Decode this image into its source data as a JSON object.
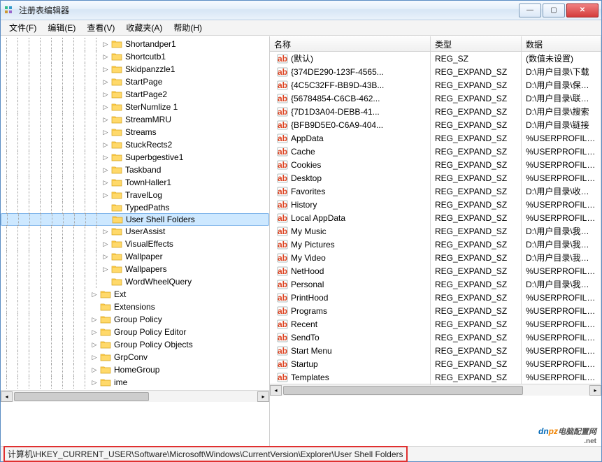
{
  "window": {
    "title": "注册表编辑器"
  },
  "menu": {
    "file": "文件(F)",
    "edit": "编辑(E)",
    "view": "查看(V)",
    "favorites": "收藏夹(A)",
    "help": "帮助(H)"
  },
  "tree": {
    "items": [
      {
        "depth": 9,
        "toggle": "▷",
        "label": "Shortandper1"
      },
      {
        "depth": 9,
        "toggle": "▷",
        "label": "Shortcutb1"
      },
      {
        "depth": 9,
        "toggle": "▷",
        "label": "Skidpanzzle1"
      },
      {
        "depth": 9,
        "toggle": "▷",
        "label": "StartPage"
      },
      {
        "depth": 9,
        "toggle": "▷",
        "label": "StartPage2"
      },
      {
        "depth": 9,
        "toggle": "▷",
        "label": "SterNumlize 1"
      },
      {
        "depth": 9,
        "toggle": "▷",
        "label": "StreamMRU"
      },
      {
        "depth": 9,
        "toggle": "▷",
        "label": "Streams"
      },
      {
        "depth": 9,
        "toggle": "▷",
        "label": "StuckRects2"
      },
      {
        "depth": 9,
        "toggle": "▷",
        "label": "Superbgestive1"
      },
      {
        "depth": 9,
        "toggle": "▷",
        "label": "Taskband"
      },
      {
        "depth": 9,
        "toggle": "▷",
        "label": "TownHaller1"
      },
      {
        "depth": 9,
        "toggle": "▷",
        "label": "TravelLog"
      },
      {
        "depth": 9,
        "toggle": "",
        "label": "TypedPaths"
      },
      {
        "depth": 9,
        "toggle": "",
        "label": "User Shell Folders",
        "selected": true
      },
      {
        "depth": 9,
        "toggle": "▷",
        "label": "UserAssist"
      },
      {
        "depth": 9,
        "toggle": "▷",
        "label": "VisualEffects"
      },
      {
        "depth": 9,
        "toggle": "▷",
        "label": "Wallpaper"
      },
      {
        "depth": 9,
        "toggle": "▷",
        "label": "Wallpapers"
      },
      {
        "depth": 9,
        "toggle": "",
        "label": "WordWheelQuery"
      },
      {
        "depth": 8,
        "toggle": "▷",
        "label": "Ext"
      },
      {
        "depth": 8,
        "toggle": "",
        "label": "Extensions"
      },
      {
        "depth": 8,
        "toggle": "▷",
        "label": "Group Policy"
      },
      {
        "depth": 8,
        "toggle": "▷",
        "label": "Group Policy Editor"
      },
      {
        "depth": 8,
        "toggle": "▷",
        "label": "Group Policy Objects"
      },
      {
        "depth": 8,
        "toggle": "▷",
        "label": "GrpConv"
      },
      {
        "depth": 8,
        "toggle": "▷",
        "label": "HomeGroup"
      },
      {
        "depth": 8,
        "toggle": "▷",
        "label": "ime"
      }
    ]
  },
  "list": {
    "headers": {
      "name": "名称",
      "type": "类型",
      "data": "数据"
    },
    "rows": [
      {
        "name": "(默认)",
        "type": "REG_SZ",
        "data": "(数值未设置)"
      },
      {
        "name": "{374DE290-123F-4565...",
        "type": "REG_EXPAND_SZ",
        "data": "D:\\用户目录\\下载"
      },
      {
        "name": "{4C5C32FF-BB9D-43B...",
        "type": "REG_EXPAND_SZ",
        "data": "D:\\用户目录\\保存的游戏"
      },
      {
        "name": "{56784854-C6CB-462...",
        "type": "REG_EXPAND_SZ",
        "data": "D:\\用户目录\\联系人"
      },
      {
        "name": "{7D1D3A04-DEBB-41...",
        "type": "REG_EXPAND_SZ",
        "data": "D:\\用户目录\\搜索"
      },
      {
        "name": "{BFB9D5E0-C6A9-404...",
        "type": "REG_EXPAND_SZ",
        "data": "D:\\用户目录\\链接"
      },
      {
        "name": "AppData",
        "type": "REG_EXPAND_SZ",
        "data": "%USERPROFILE%\\AppData\\Ro"
      },
      {
        "name": "Cache",
        "type": "REG_EXPAND_SZ",
        "data": "%USERPROFILE%\\AppData\\Lo"
      },
      {
        "name": "Cookies",
        "type": "REG_EXPAND_SZ",
        "data": "%USERPROFILE%\\AppData\\Ro"
      },
      {
        "name": "Desktop",
        "type": "REG_EXPAND_SZ",
        "data": "%USERPROFILE%\\Desktop"
      },
      {
        "name": "Favorites",
        "type": "REG_EXPAND_SZ",
        "data": "D:\\用户目录\\收藏夹"
      },
      {
        "name": "History",
        "type": "REG_EXPAND_SZ",
        "data": "%USERPROFILE%\\AppData\\Lo"
      },
      {
        "name": "Local AppData",
        "type": "REG_EXPAND_SZ",
        "data": "%USERPROFILE%\\AppData\\Lo"
      },
      {
        "name": "My Music",
        "type": "REG_EXPAND_SZ",
        "data": "D:\\用户目录\\我的音乐"
      },
      {
        "name": "My Pictures",
        "type": "REG_EXPAND_SZ",
        "data": "D:\\用户目录\\我的图片"
      },
      {
        "name": "My Video",
        "type": "REG_EXPAND_SZ",
        "data": "D:\\用户目录\\我的视频"
      },
      {
        "name": "NetHood",
        "type": "REG_EXPAND_SZ",
        "data": "%USERPROFILE%\\AppData\\Ro"
      },
      {
        "name": "Personal",
        "type": "REG_EXPAND_SZ",
        "data": "D:\\用户目录\\我的文档"
      },
      {
        "name": "PrintHood",
        "type": "REG_EXPAND_SZ",
        "data": "%USERPROFILE%\\AppData\\Ro"
      },
      {
        "name": "Programs",
        "type": "REG_EXPAND_SZ",
        "data": "%USERPROFILE%\\AppData\\Ro"
      },
      {
        "name": "Recent",
        "type": "REG_EXPAND_SZ",
        "data": "%USERPROFILE%\\AppData\\Ro"
      },
      {
        "name": "SendTo",
        "type": "REG_EXPAND_SZ",
        "data": "%USERPROFILE%\\AppData\\Ro"
      },
      {
        "name": "Start Menu",
        "type": "REG_EXPAND_SZ",
        "data": "%USERPROFILE%\\AppData\\Ro"
      },
      {
        "name": "Startup",
        "type": "REG_EXPAND_SZ",
        "data": "%USERPROFILE%\\AppData\\Ro"
      },
      {
        "name": "Templates",
        "type": "REG_EXPAND_SZ",
        "data": "%USERPROFILE%\\AppData\\Ro"
      }
    ]
  },
  "status": {
    "path": "计算机\\HKEY_CURRENT_USER\\Software\\Microsoft\\Windows\\CurrentVersion\\Explorer\\User Shell Folders"
  },
  "watermark": {
    "part1": "dn",
    "part2": "pz",
    "suffix": "电脑配置网",
    "net": ".net"
  }
}
